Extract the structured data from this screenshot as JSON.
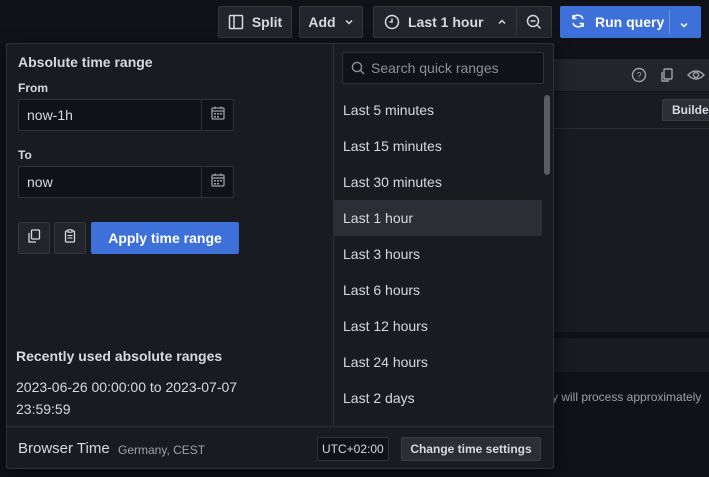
{
  "toolbar": {
    "split_label": "Split",
    "add_label": "Add",
    "time_range_label": "Last 1 hour",
    "run_query_label": "Run query"
  },
  "background": {
    "builder_label": "Builde",
    "notice_text": "y will process approximately"
  },
  "absolute": {
    "title": "Absolute time range",
    "from_label": "From",
    "from_value": "now-1h",
    "to_label": "To",
    "to_value": "now",
    "apply_label": "Apply time range"
  },
  "recent": {
    "title": "Recently used absolute ranges",
    "line1": "2023-06-26 00:00:00 to 2023-07-07",
    "line2": "23:59:59"
  },
  "quick": {
    "search_placeholder": "Search quick ranges",
    "items": [
      "Last 5 minutes",
      "Last 15 minutes",
      "Last 30 minutes",
      "Last 1 hour",
      "Last 3 hours",
      "Last 6 hours",
      "Last 12 hours",
      "Last 24 hours",
      "Last 2 days"
    ],
    "selected": "Last 1 hour"
  },
  "footer": {
    "browser_time_label": "Browser Time",
    "location": "Germany, CEST",
    "utc_offset": "UTC+02:00",
    "change_settings_label": "Change time settings"
  },
  "colors": {
    "primary": "#3d71d9",
    "background": "#111217",
    "panel": "#181b1f"
  }
}
